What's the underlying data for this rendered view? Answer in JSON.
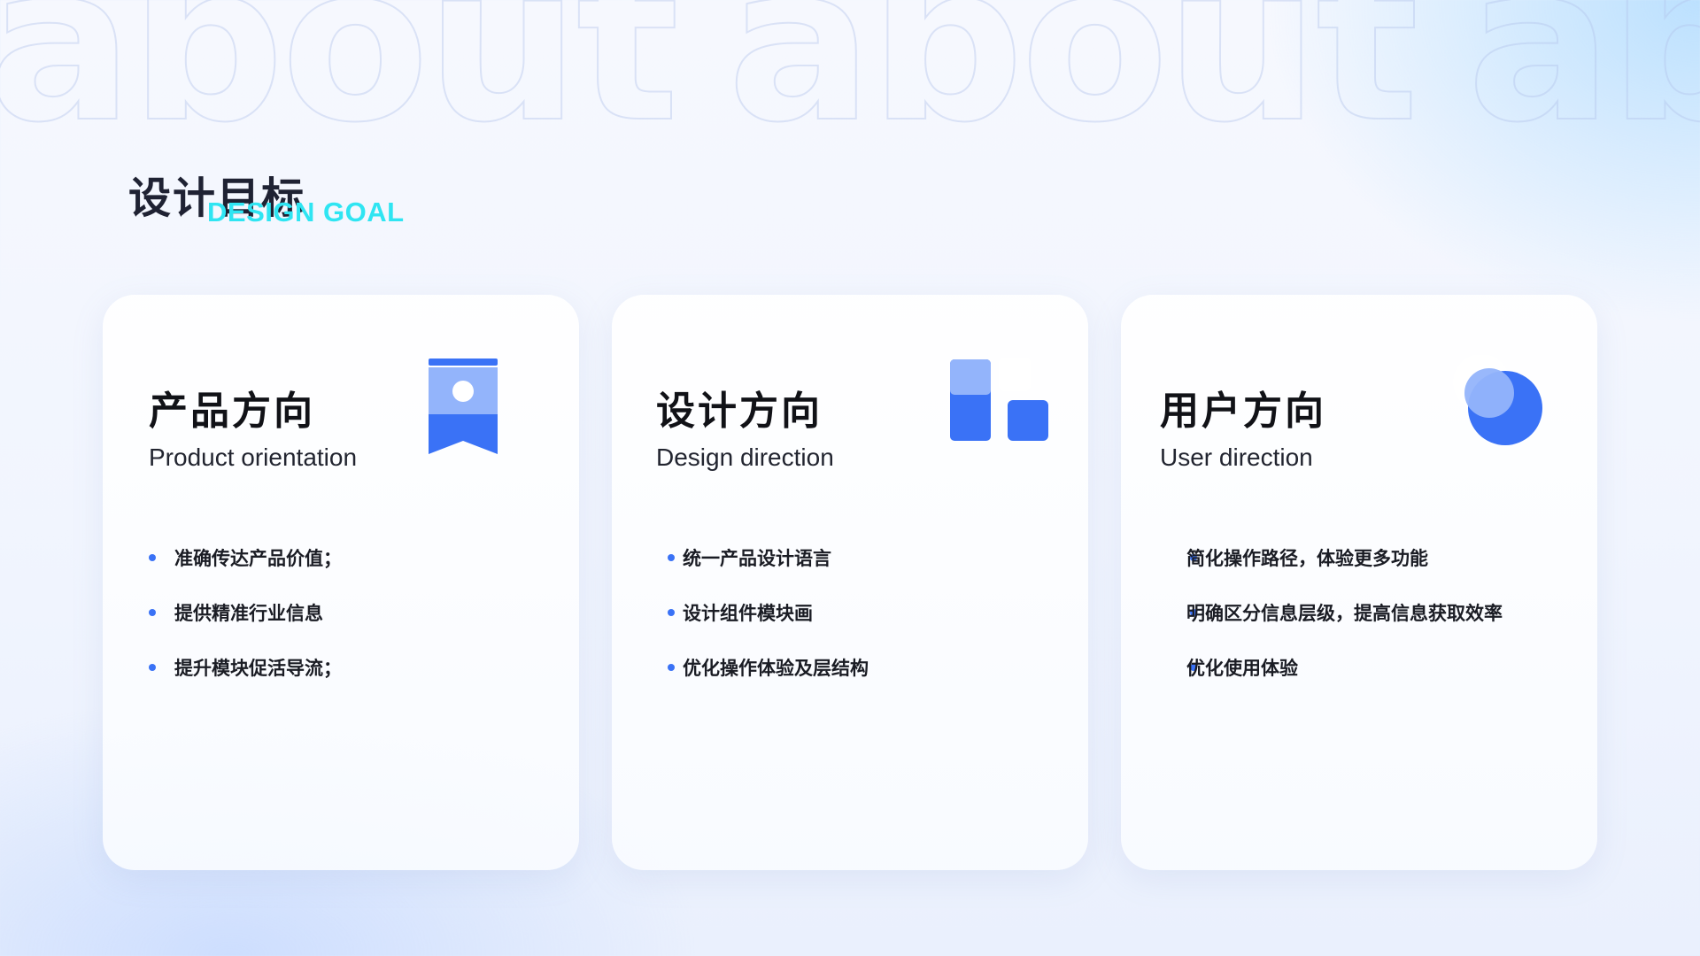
{
  "background": {
    "watermark_words": [
      "about",
      "about",
      "about"
    ]
  },
  "header": {
    "title": "设计目标",
    "subtitle": "DESIGN GOAL"
  },
  "cards": [
    {
      "title": "产品方向",
      "subtitle": "Product orientation",
      "icon": "bookmark-icon",
      "items": [
        "准确传达产品价值；",
        "提供精准行业信息",
        "提升模块促活导流；"
      ]
    },
    {
      "title": "设计方向",
      "subtitle": "Design direction",
      "icon": "blocks-icon",
      "items": [
        "统一产品设计语言",
        "设计组件模块画",
        "优化操作体验及层结构"
      ]
    },
    {
      "title": "用户方向",
      "subtitle": "User direction",
      "icon": "circle-icon",
      "items": [
        "简化操作路径，体验更多功能",
        "明确区分信息层级，提高信息获取效率",
        "优化使用体验"
      ]
    }
  ],
  "colors": {
    "accent": "#3a72f6",
    "accent_light": "#93b4fb",
    "subtitle": "#2fe5f2",
    "title": "#1f2233"
  }
}
